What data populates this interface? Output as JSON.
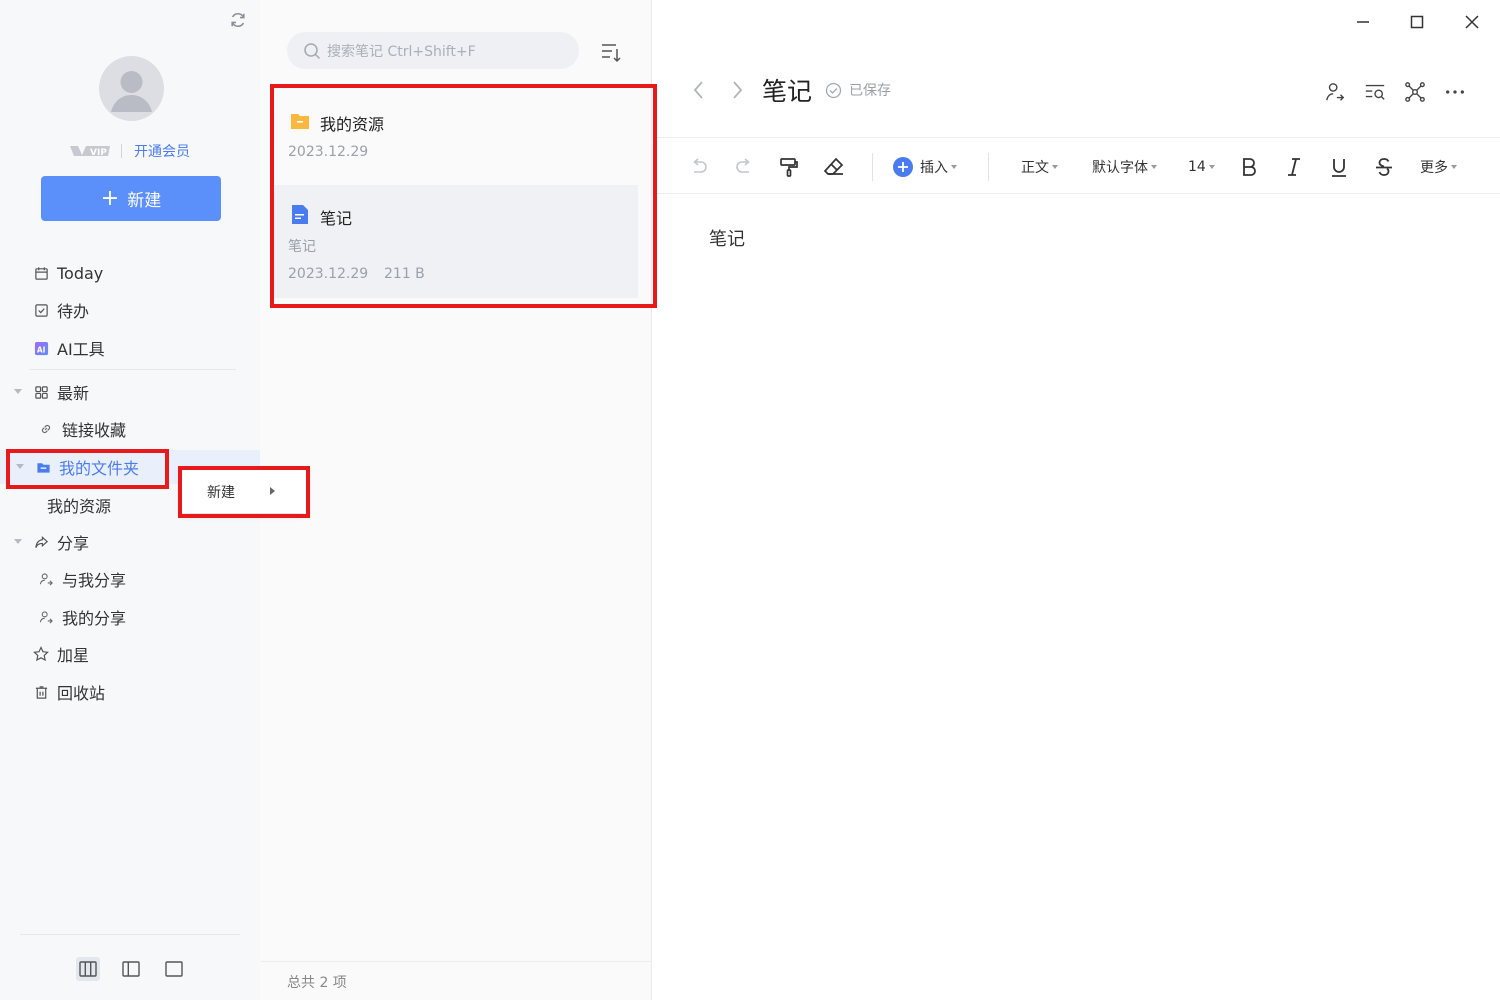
{
  "sidebar": {
    "vip_link": "开通会员",
    "new_button": "新建",
    "nav": {
      "today": "Today",
      "todo": "待办",
      "ai_tools": "AI工具",
      "recent": "最新",
      "link_favorites": "链接收藏",
      "my_folder": "我的文件夹",
      "my_resources": "我的资源",
      "share": "分享",
      "shared_with_me": "与我分享",
      "my_shares": "我的分享",
      "starred": "加星",
      "recycle_bin": "回收站"
    }
  },
  "context_menu": {
    "new_label": "新建"
  },
  "note_list": {
    "search_placeholder": "搜索笔记 Ctrl+Shift+F",
    "items": [
      {
        "type": "folder",
        "title": "我的资源",
        "date": "2023.12.29"
      },
      {
        "type": "note",
        "title": "笔记",
        "preview": "笔记",
        "date": "2023.12.29",
        "size": "211 B"
      }
    ],
    "footer": "总共 2 项"
  },
  "editor": {
    "title": "笔记",
    "status": "已保存",
    "toolbar": {
      "insert": "插入",
      "paragraph": "正文",
      "font": "默认字体",
      "font_size": "14",
      "more": "更多"
    },
    "content": "笔记"
  },
  "colors": {
    "accent": "#5b8ff9",
    "highlight_red": "#e8191b",
    "folder_yellow": "#fbb840",
    "doc_blue": "#4a7cf0"
  }
}
